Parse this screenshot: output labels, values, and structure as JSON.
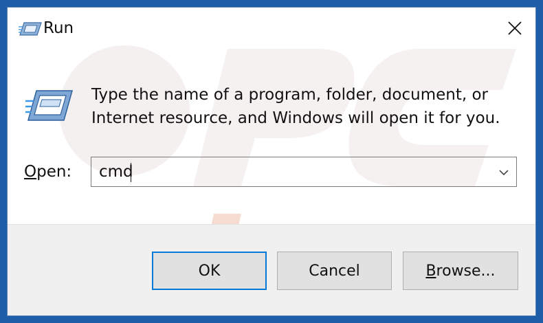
{
  "window": {
    "title": "Run",
    "title_icon": "run-icon",
    "close_icon": "close-icon"
  },
  "content": {
    "description_line1": "Type the name of a program, folder, document, or",
    "description_line2": "Internet resource, and Windows will open it for you.",
    "open_label_access_key": "O",
    "open_label_rest": "pen:",
    "open_value": "cmd",
    "dropdown_icon": "chevron-down-icon"
  },
  "buttons": {
    "ok": "OK",
    "cancel": "Cancel",
    "browse_access_key": "B",
    "browse_rest": "rowse..."
  },
  "colors": {
    "desktop_background": "#1e5ea8",
    "default_button_border": "#0078d7",
    "footer_background": "#f0f0f0",
    "button_background": "#e1e1e1"
  }
}
